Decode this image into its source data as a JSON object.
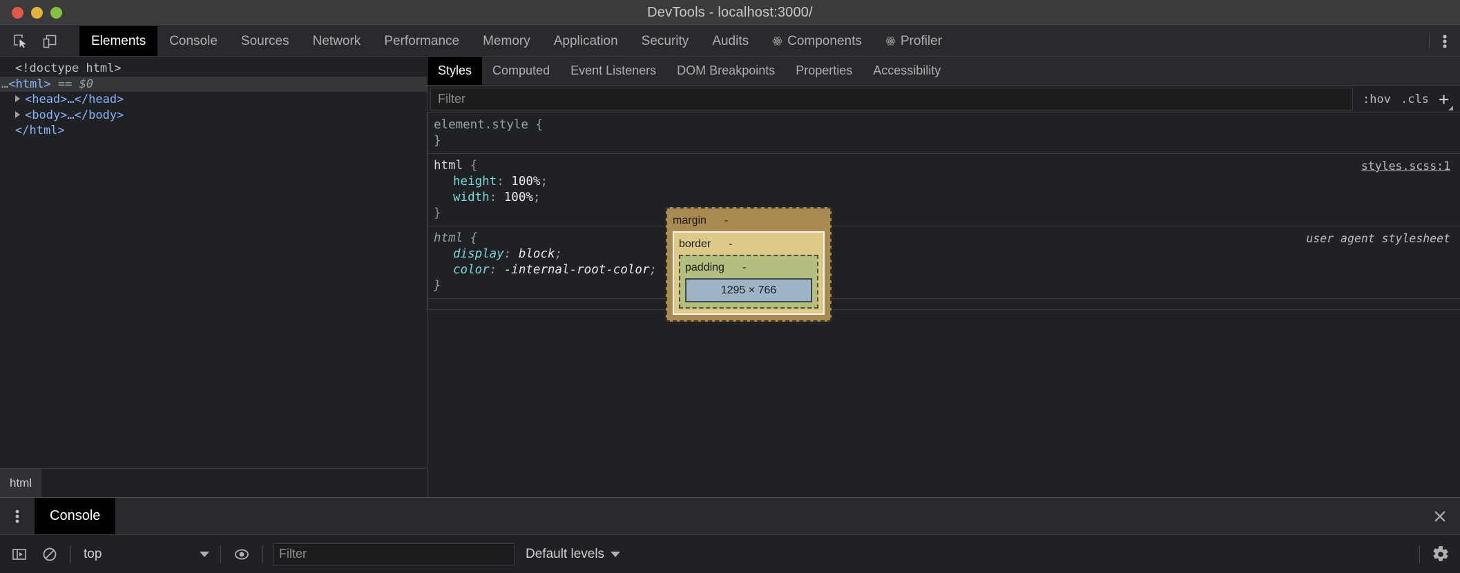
{
  "window": {
    "title": "DevTools - localhost:3000/",
    "traffic_lights": [
      "close",
      "minimize",
      "zoom"
    ],
    "colors": {
      "close": "#e3574a",
      "minimize": "#e0b43c",
      "zoom": "#84bf40"
    }
  },
  "toolbar": {
    "inspect_icon": "inspect-cursor-icon",
    "device_icon": "device-toolbar-icon",
    "more_icon": "kebab-menu-icon"
  },
  "main_tabs": [
    {
      "label": "Elements",
      "active": true,
      "icon": null
    },
    {
      "label": "Console",
      "active": false,
      "icon": null
    },
    {
      "label": "Sources",
      "active": false,
      "icon": null
    },
    {
      "label": "Network",
      "active": false,
      "icon": null
    },
    {
      "label": "Performance",
      "active": false,
      "icon": null
    },
    {
      "label": "Memory",
      "active": false,
      "icon": null
    },
    {
      "label": "Application",
      "active": false,
      "icon": null
    },
    {
      "label": "Security",
      "active": false,
      "icon": null
    },
    {
      "label": "Audits",
      "active": false,
      "icon": null
    },
    {
      "label": "Components",
      "active": false,
      "icon": "react-atom-icon"
    },
    {
      "label": "Profiler",
      "active": false,
      "icon": "react-atom-icon"
    }
  ],
  "dom_tree": {
    "lines": [
      {
        "text": "<!doctype html>",
        "kind": "doctype"
      },
      {
        "text": "<html>",
        "kind": "open",
        "selected": true,
        "suffix": "== $0",
        "leading_ellipsis": "…"
      },
      {
        "text": "<head>…</head>",
        "kind": "collapsed",
        "twisty": true
      },
      {
        "text": "<body>…</body>",
        "kind": "collapsed",
        "twisty": true
      },
      {
        "text": "</html>",
        "kind": "close"
      }
    ]
  },
  "breadcrumb": {
    "items": [
      "html"
    ]
  },
  "styles_tabs": [
    {
      "label": "Styles",
      "active": true
    },
    {
      "label": "Computed",
      "active": false
    },
    {
      "label": "Event Listeners",
      "active": false
    },
    {
      "label": "DOM Breakpoints",
      "active": false
    },
    {
      "label": "Properties",
      "active": false
    },
    {
      "label": "Accessibility",
      "active": false
    }
  ],
  "styles_filter": {
    "placeholder": "Filter",
    "value": "",
    "hov_label": ":hov",
    "cls_label": ".cls",
    "new_rule_label": "+"
  },
  "css_rules": [
    {
      "selector": "element.style",
      "origin": "",
      "origin_is_link": false,
      "muted": true,
      "italic": false,
      "declarations": []
    },
    {
      "selector": "html",
      "origin": "styles.scss:1",
      "origin_is_link": true,
      "muted": false,
      "italic": false,
      "declarations": [
        {
          "property": "height",
          "value": "100%"
        },
        {
          "property": "width",
          "value": "100%"
        }
      ]
    },
    {
      "selector": "html",
      "origin": "user agent stylesheet",
      "origin_is_link": false,
      "muted": true,
      "italic": true,
      "declarations": [
        {
          "property": "display",
          "value": "block"
        },
        {
          "property": "color",
          "value": "-internal-root-color"
        }
      ]
    }
  ],
  "box_model": {
    "margin": {
      "label": "margin",
      "value": "-"
    },
    "border": {
      "label": "border",
      "value": "-"
    },
    "padding": {
      "label": "padding",
      "value": "-"
    },
    "content": {
      "value": "1295 × 766"
    },
    "colors": {
      "margin": "#a98b52",
      "border": "#ddca89",
      "padding": "#b5bd7f",
      "content": "#9db4c6"
    }
  },
  "drawer": {
    "menu_icon": "kebab-menu-icon",
    "tabs": [
      {
        "label": "Console",
        "active": true
      }
    ],
    "close_icon": "close-icon",
    "console_toolbar": {
      "sidebar_icon": "show-console-sidebar-icon",
      "clear_icon": "clear-console-icon",
      "context": "top",
      "eye_icon": "live-expression-icon",
      "filter_placeholder": "Filter",
      "filter_value": "",
      "levels_label": "Default levels",
      "settings_icon": "gear-icon"
    }
  }
}
